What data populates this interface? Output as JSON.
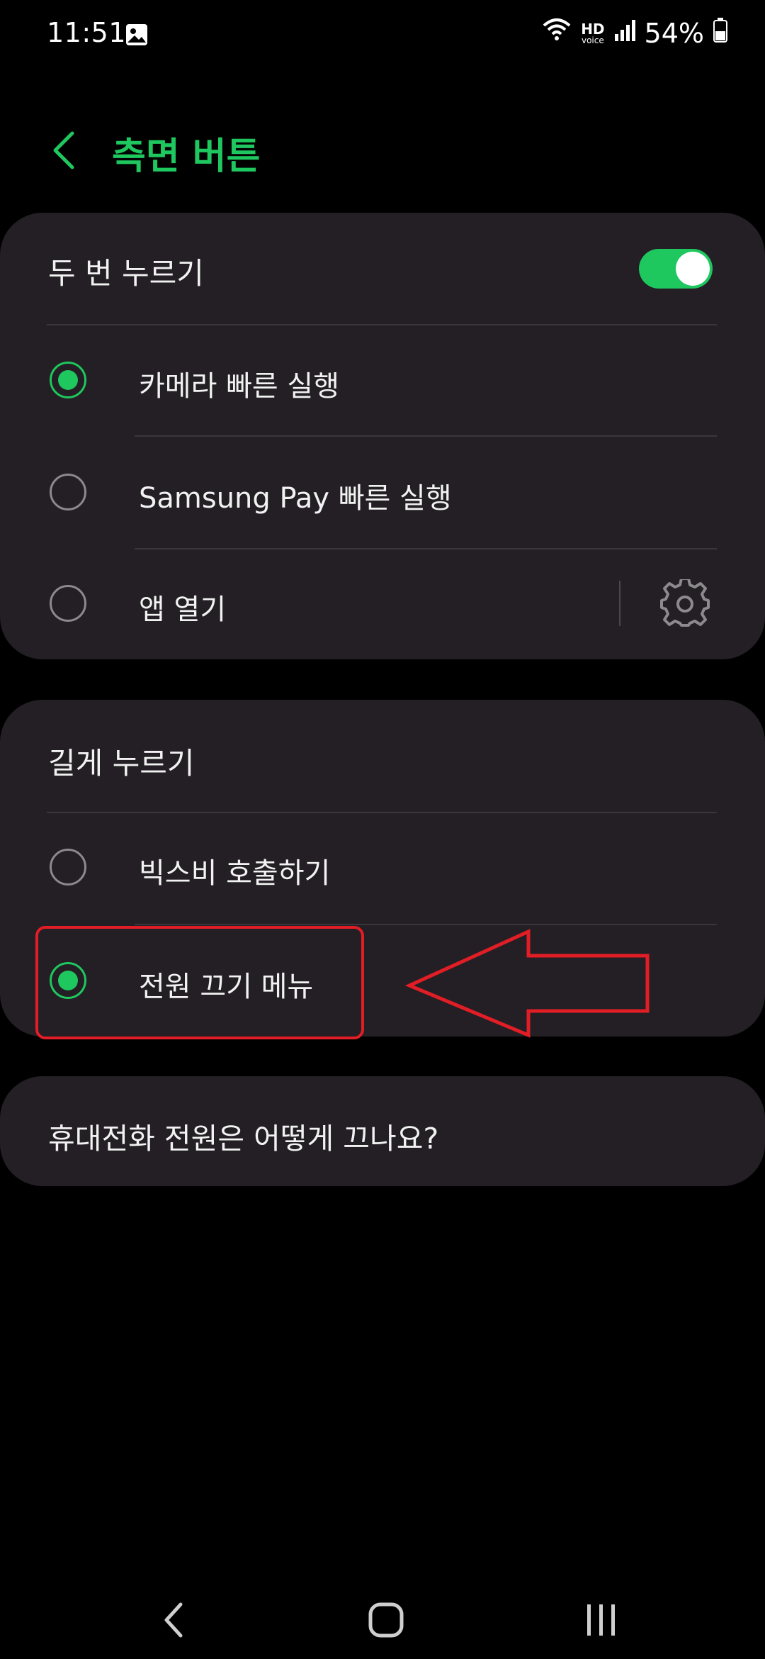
{
  "status_bar": {
    "time": "11:51",
    "hd": "HD",
    "voice": "voice",
    "battery": "54%",
    "icons": [
      "gallery-icon",
      "wifi-icon",
      "signal-icon",
      "battery-icon"
    ]
  },
  "header": {
    "title": "측면 버튼",
    "back_icon": "chevron-left-icon"
  },
  "double_press": {
    "title": "두 번 누르기",
    "enabled": true,
    "options": [
      {
        "label": "카메라 빠른 실행",
        "selected": true
      },
      {
        "label": "Samsung Pay 빠른 실행",
        "selected": false
      },
      {
        "label": "앱 열기",
        "selected": false,
        "icon": "gear-icon"
      }
    ]
  },
  "long_press": {
    "title": "길게 누르기",
    "options": [
      {
        "label": "빅스비 호출하기",
        "selected": false
      },
      {
        "label": "전원 끄기 메뉴",
        "selected": true
      }
    ]
  },
  "help_link": {
    "label": "휴대전화 전원은 어떻게 끄나요?"
  },
  "colors": {
    "accent": "#1fc75f",
    "card_bg": "#231f24",
    "annotation_red": "#e11d25"
  }
}
